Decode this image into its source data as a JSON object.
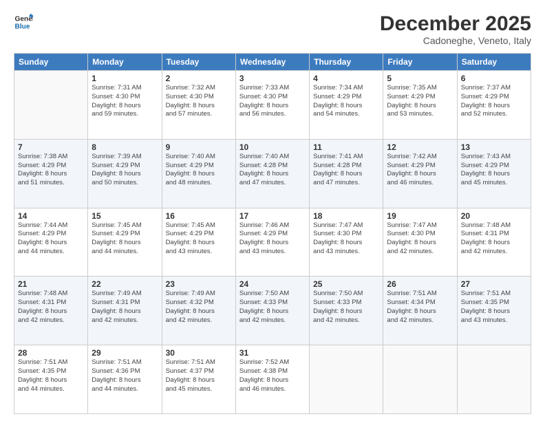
{
  "logo": {
    "line1": "General",
    "line2": "Blue"
  },
  "header": {
    "month": "December 2025",
    "location": "Cadoneghe, Veneto, Italy"
  },
  "weekdays": [
    "Sunday",
    "Monday",
    "Tuesday",
    "Wednesday",
    "Thursday",
    "Friday",
    "Saturday"
  ],
  "weeks": [
    [
      {
        "day": "",
        "info": ""
      },
      {
        "day": "1",
        "info": "Sunrise: 7:31 AM\nSunset: 4:30 PM\nDaylight: 8 hours\nand 59 minutes."
      },
      {
        "day": "2",
        "info": "Sunrise: 7:32 AM\nSunset: 4:30 PM\nDaylight: 8 hours\nand 57 minutes."
      },
      {
        "day": "3",
        "info": "Sunrise: 7:33 AM\nSunset: 4:30 PM\nDaylight: 8 hours\nand 56 minutes."
      },
      {
        "day": "4",
        "info": "Sunrise: 7:34 AM\nSunset: 4:29 PM\nDaylight: 8 hours\nand 54 minutes."
      },
      {
        "day": "5",
        "info": "Sunrise: 7:35 AM\nSunset: 4:29 PM\nDaylight: 8 hours\nand 53 minutes."
      },
      {
        "day": "6",
        "info": "Sunrise: 7:37 AM\nSunset: 4:29 PM\nDaylight: 8 hours\nand 52 minutes."
      }
    ],
    [
      {
        "day": "7",
        "info": "Sunrise: 7:38 AM\nSunset: 4:29 PM\nDaylight: 8 hours\nand 51 minutes."
      },
      {
        "day": "8",
        "info": "Sunrise: 7:39 AM\nSunset: 4:29 PM\nDaylight: 8 hours\nand 50 minutes."
      },
      {
        "day": "9",
        "info": "Sunrise: 7:40 AM\nSunset: 4:29 PM\nDaylight: 8 hours\nand 48 minutes."
      },
      {
        "day": "10",
        "info": "Sunrise: 7:40 AM\nSunset: 4:28 PM\nDaylight: 8 hours\nand 47 minutes."
      },
      {
        "day": "11",
        "info": "Sunrise: 7:41 AM\nSunset: 4:28 PM\nDaylight: 8 hours\nand 47 minutes."
      },
      {
        "day": "12",
        "info": "Sunrise: 7:42 AM\nSunset: 4:29 PM\nDaylight: 8 hours\nand 46 minutes."
      },
      {
        "day": "13",
        "info": "Sunrise: 7:43 AM\nSunset: 4:29 PM\nDaylight: 8 hours\nand 45 minutes."
      }
    ],
    [
      {
        "day": "14",
        "info": "Sunrise: 7:44 AM\nSunset: 4:29 PM\nDaylight: 8 hours\nand 44 minutes."
      },
      {
        "day": "15",
        "info": "Sunrise: 7:45 AM\nSunset: 4:29 PM\nDaylight: 8 hours\nand 44 minutes."
      },
      {
        "day": "16",
        "info": "Sunrise: 7:45 AM\nSunset: 4:29 PM\nDaylight: 8 hours\nand 43 minutes."
      },
      {
        "day": "17",
        "info": "Sunrise: 7:46 AM\nSunset: 4:29 PM\nDaylight: 8 hours\nand 43 minutes."
      },
      {
        "day": "18",
        "info": "Sunrise: 7:47 AM\nSunset: 4:30 PM\nDaylight: 8 hours\nand 43 minutes."
      },
      {
        "day": "19",
        "info": "Sunrise: 7:47 AM\nSunset: 4:30 PM\nDaylight: 8 hours\nand 42 minutes."
      },
      {
        "day": "20",
        "info": "Sunrise: 7:48 AM\nSunset: 4:31 PM\nDaylight: 8 hours\nand 42 minutes."
      }
    ],
    [
      {
        "day": "21",
        "info": "Sunrise: 7:48 AM\nSunset: 4:31 PM\nDaylight: 8 hours\nand 42 minutes."
      },
      {
        "day": "22",
        "info": "Sunrise: 7:49 AM\nSunset: 4:31 PM\nDaylight: 8 hours\nand 42 minutes."
      },
      {
        "day": "23",
        "info": "Sunrise: 7:49 AM\nSunset: 4:32 PM\nDaylight: 8 hours\nand 42 minutes."
      },
      {
        "day": "24",
        "info": "Sunrise: 7:50 AM\nSunset: 4:33 PM\nDaylight: 8 hours\nand 42 minutes."
      },
      {
        "day": "25",
        "info": "Sunrise: 7:50 AM\nSunset: 4:33 PM\nDaylight: 8 hours\nand 42 minutes."
      },
      {
        "day": "26",
        "info": "Sunrise: 7:51 AM\nSunset: 4:34 PM\nDaylight: 8 hours\nand 42 minutes."
      },
      {
        "day": "27",
        "info": "Sunrise: 7:51 AM\nSunset: 4:35 PM\nDaylight: 8 hours\nand 43 minutes."
      }
    ],
    [
      {
        "day": "28",
        "info": "Sunrise: 7:51 AM\nSunset: 4:35 PM\nDaylight: 8 hours\nand 44 minutes."
      },
      {
        "day": "29",
        "info": "Sunrise: 7:51 AM\nSunset: 4:36 PM\nDaylight: 8 hours\nand 44 minutes."
      },
      {
        "day": "30",
        "info": "Sunrise: 7:51 AM\nSunset: 4:37 PM\nDaylight: 8 hours\nand 45 minutes."
      },
      {
        "day": "31",
        "info": "Sunrise: 7:52 AM\nSunset: 4:38 PM\nDaylight: 8 hours\nand 46 minutes."
      },
      {
        "day": "",
        "info": ""
      },
      {
        "day": "",
        "info": ""
      },
      {
        "day": "",
        "info": ""
      }
    ]
  ]
}
